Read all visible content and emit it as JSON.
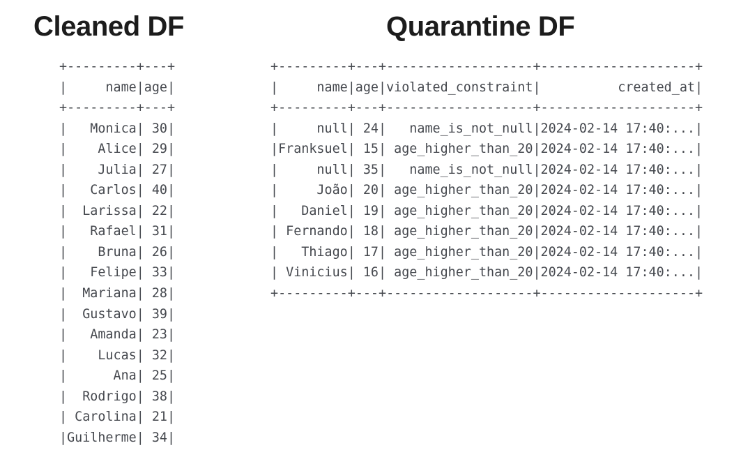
{
  "background_color": "#ffffff",
  "text_color": "#45484e",
  "title_color": "#1c1c1c",
  "panels": {
    "cleaned": {
      "title": "Cleaned DF",
      "table": {
        "columns": [
          {
            "name": "name",
            "width": 9,
            "align": "right"
          },
          {
            "name": "age",
            "width": 3,
            "align": "right"
          }
        ],
        "rows": [
          {
            "name": "Monica",
            "age": "30"
          },
          {
            "name": "Alice",
            "age": "29"
          },
          {
            "name": "Julia",
            "age": "27"
          },
          {
            "name": "Carlos",
            "age": "40"
          },
          {
            "name": "Larissa",
            "age": "22"
          },
          {
            "name": "Rafael",
            "age": "31"
          },
          {
            "name": "Bruna",
            "age": "26"
          },
          {
            "name": "Felipe",
            "age": "33"
          },
          {
            "name": "Mariana",
            "age": "28"
          },
          {
            "name": "Gustavo",
            "age": "39"
          },
          {
            "name": "Amanda",
            "age": "23"
          },
          {
            "name": "Lucas",
            "age": "32"
          },
          {
            "name": "Ana",
            "age": "25"
          },
          {
            "name": "Rodrigo",
            "age": "38"
          },
          {
            "name": "Carolina",
            "age": "21"
          },
          {
            "name": "Guilherme",
            "age": "34"
          }
        ],
        "has_bottom_rule": false,
        "truncated": true
      }
    },
    "quarantine": {
      "title": "Quarantine DF",
      "table": {
        "columns": [
          {
            "name": "name",
            "width": 9,
            "align": "right"
          },
          {
            "name": "age",
            "width": 3,
            "align": "right"
          },
          {
            "name": "violated_constraint",
            "width": 19,
            "align": "right"
          },
          {
            "name": "created_at",
            "width": 20,
            "align": "right"
          }
        ],
        "rows": [
          {
            "name": "null",
            "age": "24",
            "violated_constraint": "name_is_not_null",
            "created_at": "2024-02-14 17:40:..."
          },
          {
            "name": "Franksuel",
            "age": "15",
            "violated_constraint": "age_higher_than_20",
            "created_at": "2024-02-14 17:40:..."
          },
          {
            "name": "null",
            "age": "35",
            "violated_constraint": "name_is_not_null",
            "created_at": "2024-02-14 17:40:..."
          },
          {
            "name": "João",
            "age": "20",
            "violated_constraint": "age_higher_than_20",
            "created_at": "2024-02-14 17:40:..."
          },
          {
            "name": "Daniel",
            "age": "19",
            "violated_constraint": "age_higher_than_20",
            "created_at": "2024-02-14 17:40:..."
          },
          {
            "name": "Fernando",
            "age": "18",
            "violated_constraint": "age_higher_than_20",
            "created_at": "2024-02-14 17:40:..."
          },
          {
            "name": "Thiago",
            "age": "17",
            "violated_constraint": "age_higher_than_20",
            "created_at": "2024-02-14 17:40:..."
          },
          {
            "name": "Vinicius",
            "age": "16",
            "violated_constraint": "age_higher_than_20",
            "created_at": "2024-02-14 17:40:..."
          }
        ],
        "has_bottom_rule": true,
        "truncated": false
      }
    }
  }
}
